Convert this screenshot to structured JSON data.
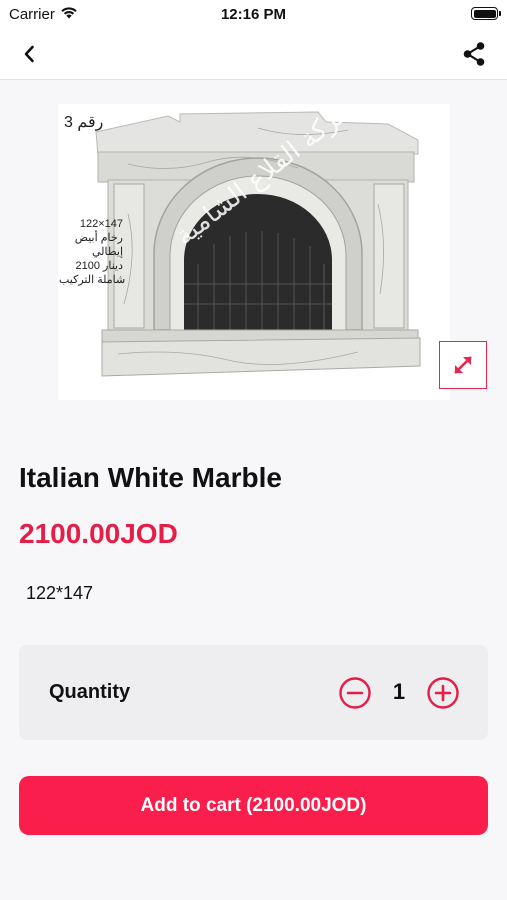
{
  "status_bar": {
    "carrier": "Carrier",
    "time": "12:16 PM",
    "icons": [
      "wifi-icon",
      "battery-icon"
    ]
  },
  "nav": {
    "back_icon": "chevron-left-icon",
    "share_icon": "share-icon"
  },
  "product": {
    "image": {
      "caption_number": "رقم 3",
      "side_text": [
        "122×147",
        "رخام أبيض",
        "إيطالي",
        "2100 دينار",
        "شاملة التركيب"
      ],
      "watermark": "شركة القلاع الشامية",
      "expand_icon": "expand-arrows-icon"
    },
    "title": "Italian White Marble",
    "price": "2100.00JOD",
    "description": "122*147"
  },
  "quantity": {
    "label": "Quantity",
    "value": "1",
    "minus_icon": "minus-circle-icon",
    "plus_icon": "plus-circle-icon"
  },
  "cart_button": {
    "label": "Add to cart (2100.00JOD)"
  },
  "colors": {
    "accent": "#f91e4c",
    "price": "#e51e48",
    "background": "#f7f7f9",
    "card": "#eeeef1"
  }
}
